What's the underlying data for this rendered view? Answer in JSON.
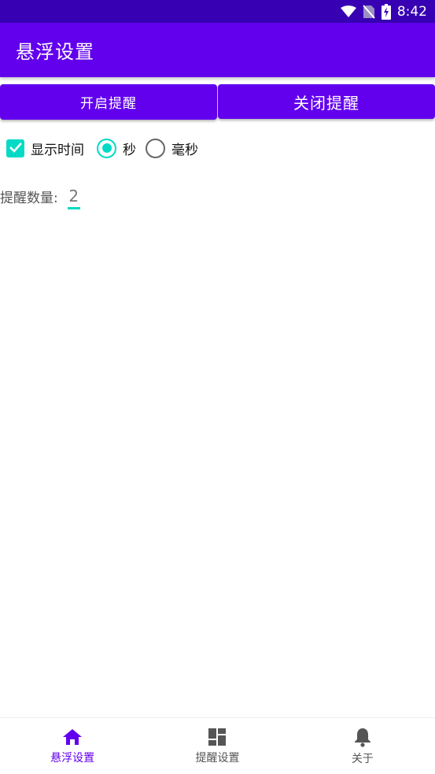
{
  "status_bar": {
    "time": "8:42",
    "icons": [
      "wifi-icon",
      "no-sim-icon",
      "battery-charging-icon"
    ]
  },
  "app_bar": {
    "title": "悬浮设置"
  },
  "buttons": {
    "open_label": "开启提醒",
    "close_label": "关闭提醒"
  },
  "options": {
    "show_time_label": "显示时间",
    "show_time_checked": true,
    "unit_seconds_label": "秒",
    "unit_millis_label": "毫秒",
    "selected_unit": "秒"
  },
  "reminder_count": {
    "label": "提醒数量:",
    "value": "2"
  },
  "bottom_nav": {
    "items": [
      {
        "label": "悬浮设置",
        "icon": "home-icon",
        "active": true
      },
      {
        "label": "提醒设置",
        "icon": "dashboard-icon",
        "active": false
      },
      {
        "label": "关于",
        "icon": "bell-icon",
        "active": false
      }
    ]
  },
  "colors": {
    "primary": "#6200ee",
    "primary_dark": "#3700b3",
    "accent": "#03dac5"
  }
}
